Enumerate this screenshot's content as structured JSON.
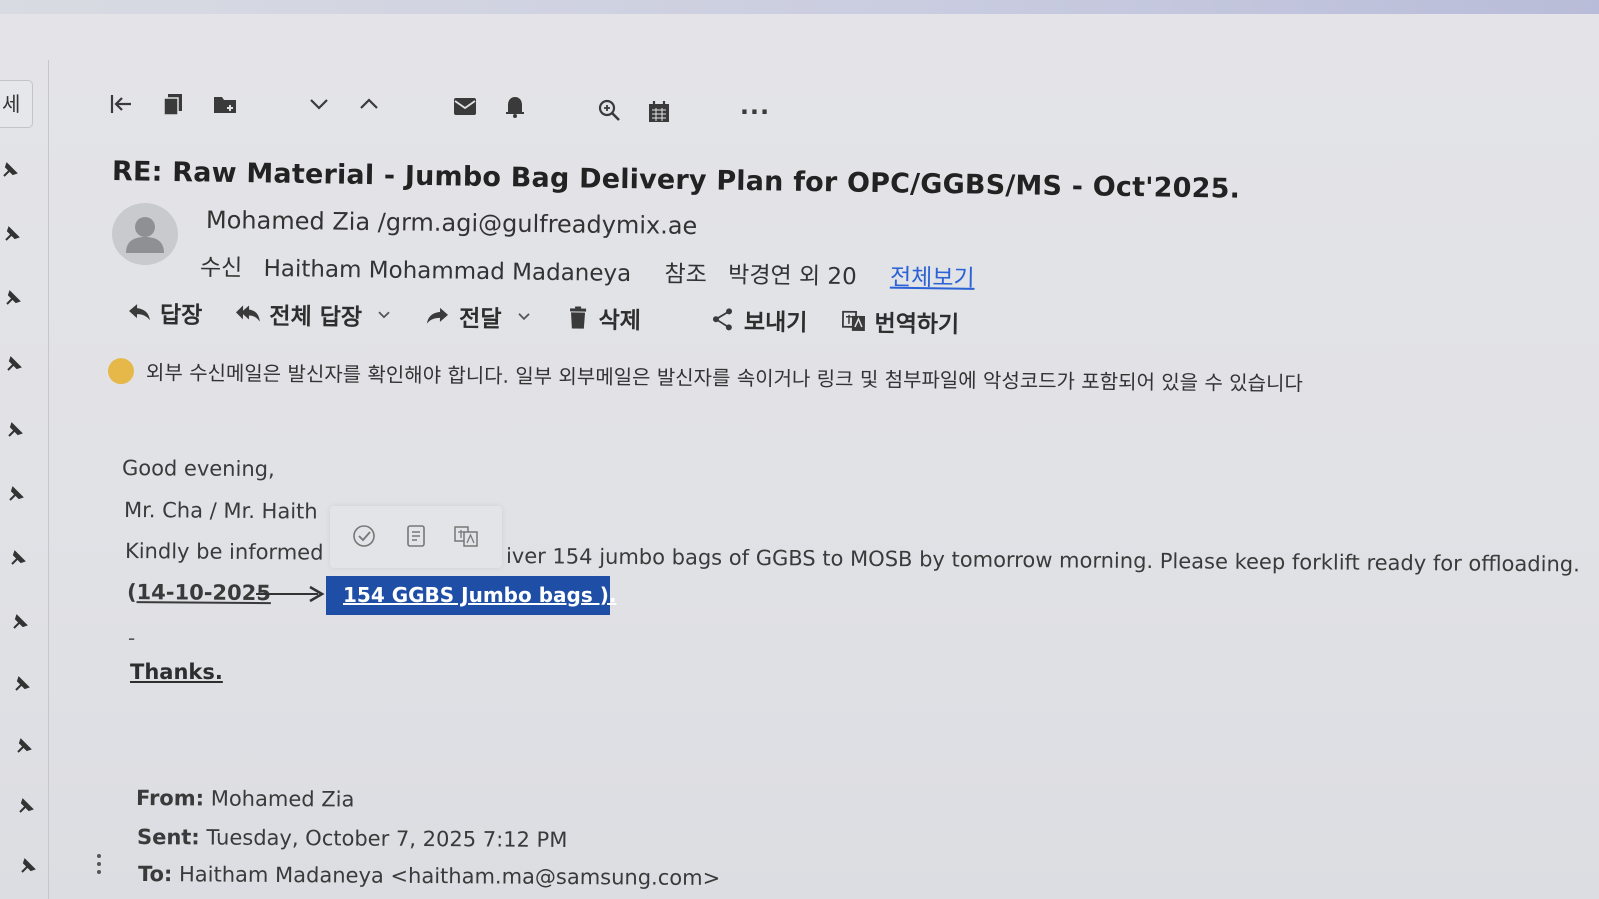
{
  "toolbar": {
    "icons": [
      "back-to-list-icon",
      "copy-icon",
      "move-folder-icon",
      "next-down-icon",
      "previous-up-icon",
      "mail-icon",
      "bell-icon",
      "zoom-icon",
      "calendar-icon",
      "more-icon"
    ],
    "more_label": "···"
  },
  "left_rail": {
    "tab_label": "세"
  },
  "email": {
    "subject": "RE: Raw Material - Jumbo Bag Delivery Plan for OPC/GGBS/MS - Oct'2025.",
    "sender": "Mohamed Zia  /grm.agi@gulfreadymix.ae",
    "to_label": "수신",
    "to_value": "Haitham Mohammad Madaneya",
    "cc_label": "참조",
    "cc_value": "박경연 외 20",
    "view_all": "전체보기"
  },
  "actions": {
    "reply": "답장",
    "reply_all": "전체 답장",
    "forward": "전달",
    "delete": "삭제",
    "share": "보내기",
    "translate": "번역하기"
  },
  "warning": {
    "text": "외부 수신메일은 발신자를 확인해야 합니다. 일부 외부메일은 발신자를 속이거나 링크 및 첨부파일에 악성코드가 포함되어 있을 수 있습니다"
  },
  "body": {
    "greeting": "Good evening,",
    "salutation": "Mr. Cha / Mr. Haith",
    "line1_start": "Kindly be informed",
    "line1_end": "iver 154  jumbo bags of GGBS to MOSB by tomorrow morning. Please keep forklift ready for offloading.",
    "date_open": "(",
    "date": "14-10-2025",
    "selected_text": "154   GGBS Jumbo bags ).",
    "dash": "-",
    "thanks": "Thanks."
  },
  "quoted_header": {
    "from_label": "From:",
    "from_value": "Mohamed Zia",
    "sent_label": "Sent:",
    "sent_value": "Tuesday, October 7, 2025 7:12 PM",
    "to_label": "To:",
    "to_value": "Haitham Madaneya <haitham.ma@samsung.com>"
  },
  "colors": {
    "link": "#2b63d6",
    "selection": "#1f4ea6",
    "warning": "#e6b84a"
  }
}
